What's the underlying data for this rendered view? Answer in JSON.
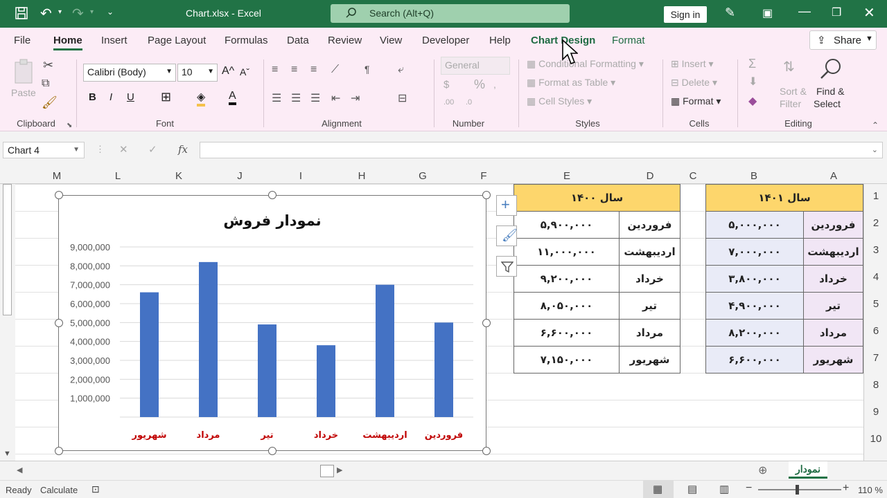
{
  "window": {
    "title": "Chart.xlsx - Excel",
    "search_placeholder": "Search (Alt+Q)",
    "signin": "Sign in"
  },
  "tabs": [
    "File",
    "Home",
    "Insert",
    "Page Layout",
    "Formulas",
    "Data",
    "Review",
    "View",
    "Developer",
    "Help",
    "Chart Design",
    "Format"
  ],
  "share": "Share",
  "ribbon": {
    "clipboard": {
      "paste": "Paste",
      "group": "Clipboard"
    },
    "font": {
      "name": "Calibri (Body)",
      "size": "10",
      "group": "Font"
    },
    "alignment": {
      "group": "Alignment"
    },
    "number": {
      "format": "General",
      "group": "Number"
    },
    "styles": {
      "cond": "Conditional Formatting",
      "table": "Format as Table",
      "cell": "Cell Styles",
      "group": "Styles"
    },
    "cells": {
      "insert": "Insert",
      "delete": "Delete",
      "format": "Format",
      "group": "Cells"
    },
    "editing": {
      "sort": "Sort &",
      "filter": "Filter",
      "find": "Find &",
      "select": "Select",
      "group": "Editing"
    }
  },
  "namebox": "Chart 4",
  "fx": "fx",
  "columns": [
    "M",
    "L",
    "K",
    "J",
    "I",
    "H",
    "G",
    "F",
    "E",
    "D",
    "C",
    "B",
    "A"
  ],
  "rows": [
    "1",
    "2",
    "3",
    "4",
    "5",
    "6",
    "7",
    "8",
    "9",
    "10"
  ],
  "table1400": {
    "header": "سال ۱۴۰۰",
    "months": [
      "فروردین",
      "اردیبهشت",
      "خرداد",
      "تیر",
      "مرداد",
      "شهریور"
    ],
    "values": [
      "۵,۹۰۰,۰۰۰",
      "۱۱,۰۰۰,۰۰۰",
      "۹,۲۰۰,۰۰۰",
      "۸,۰۵۰,۰۰۰",
      "۶,۶۰۰,۰۰۰",
      "۷,۱۵۰,۰۰۰"
    ]
  },
  "table1401": {
    "header": "سال ۱۴۰۱",
    "months": [
      "فروردین",
      "اردیبهشت",
      "خرداد",
      "تیر",
      "مرداد",
      "شهریور"
    ],
    "values": [
      "۵,۰۰۰,۰۰۰",
      "۷,۰۰۰,۰۰۰",
      "۳,۸۰۰,۰۰۰",
      "۴,۹۰۰,۰۰۰",
      "۸,۲۰۰,۰۰۰",
      "۶,۶۰۰,۰۰۰"
    ]
  },
  "chart_data": {
    "type": "bar",
    "title": "نمودار فروش",
    "categories": [
      "فروردین",
      "اردیبهشت",
      "خرداد",
      "تیر",
      "مرداد",
      "شهریور"
    ],
    "values": [
      5000000,
      7000000,
      3800000,
      4900000,
      8200000,
      6600000
    ],
    "yticks": [
      "1,000,000",
      "2,000,000",
      "3,000,000",
      "4,000,000",
      "5,000,000",
      "6,000,000",
      "7,000,000",
      "8,000,000",
      "9,000,000"
    ],
    "ylim": [
      0,
      9000000
    ],
    "bar_color": "#4472c4",
    "category_color": "#c00000"
  },
  "sheet_tab": "نمودار",
  "status": {
    "ready": "Ready",
    "calculate": "Calculate",
    "zoom": "110 %"
  }
}
